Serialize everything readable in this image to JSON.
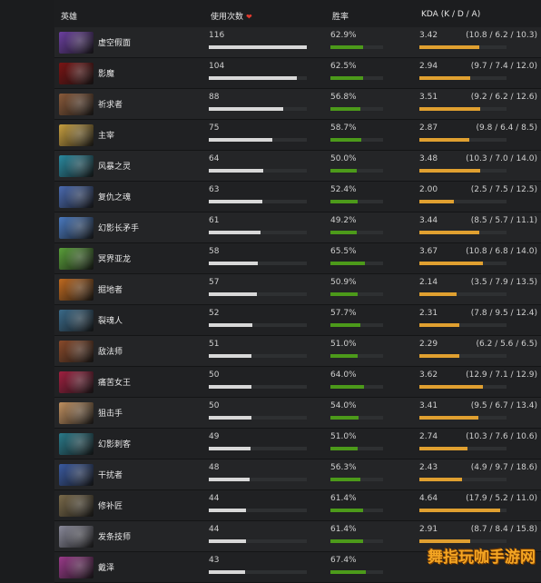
{
  "header": {
    "hero": "英雄",
    "matches": "使用次数",
    "win_rate": "胜率",
    "kda": "KDA (K / D / A)"
  },
  "max_matches": 116,
  "max_kda": 5.0,
  "rows": [
    {
      "hero": "虚空假面",
      "matches": "116",
      "win": "62.9%",
      "kda": "3.42",
      "kda_detail": "(10.8 / 6.2 / 10.3)",
      "m": 116,
      "w": 62.9,
      "k": 3.42,
      "color": "#6b3fa0"
    },
    {
      "hero": "影魔",
      "matches": "104",
      "win": "62.5%",
      "kda": "2.94",
      "kda_detail": "(9.7 / 7.4 / 12.0)",
      "m": 104,
      "w": 62.5,
      "k": 2.94,
      "color": "#7a1414"
    },
    {
      "hero": "祈求者",
      "matches": "88",
      "win": "56.8%",
      "kda": "3.51",
      "kda_detail": "(9.2 / 6.2 / 12.6)",
      "m": 88,
      "w": 56.8,
      "k": 3.51,
      "color": "#8a5a3a"
    },
    {
      "hero": "主宰",
      "matches": "75",
      "win": "58.7%",
      "kda": "2.87",
      "kda_detail": "(9.8 / 6.4 / 8.5)",
      "m": 75,
      "w": 58.7,
      "k": 2.87,
      "color": "#c8a040"
    },
    {
      "hero": "风暴之灵",
      "matches": "64",
      "win": "50.0%",
      "kda": "3.48",
      "kda_detail": "(10.3 / 7.0 / 14.0)",
      "m": 64,
      "w": 50.0,
      "k": 3.48,
      "color": "#2a8aa0"
    },
    {
      "hero": "复仇之魂",
      "matches": "63",
      "win": "52.4%",
      "kda": "2.00",
      "kda_detail": "(2.5 / 7.5 / 12.5)",
      "m": 63,
      "w": 52.4,
      "k": 2.0,
      "color": "#4a6ab0"
    },
    {
      "hero": "幻影长矛手",
      "matches": "61",
      "win": "49.2%",
      "kda": "3.44",
      "kda_detail": "(8.5 / 5.7 / 11.1)",
      "m": 61,
      "w": 49.2,
      "k": 3.44,
      "color": "#4a7ac0"
    },
    {
      "hero": "冥界亚龙",
      "matches": "58",
      "win": "65.5%",
      "kda": "3.67",
      "kda_detail": "(10.8 / 6.8 / 14.0)",
      "m": 58,
      "w": 65.5,
      "k": 3.67,
      "color": "#5aa03a"
    },
    {
      "hero": "掘地者",
      "matches": "57",
      "win": "50.9%",
      "kda": "2.14",
      "kda_detail": "(3.5 / 7.9 / 13.5)",
      "m": 57,
      "w": 50.9,
      "k": 2.14,
      "color": "#c06a20"
    },
    {
      "hero": "裂魂人",
      "matches": "52",
      "win": "57.7%",
      "kda": "2.31",
      "kda_detail": "(7.8 / 9.5 / 12.4)",
      "m": 52,
      "w": 57.7,
      "k": 2.31,
      "color": "#3a6a8a"
    },
    {
      "hero": "敌法师",
      "matches": "51",
      "win": "51.0%",
      "kda": "2.29",
      "kda_detail": "(6.2 / 5.6 / 6.5)",
      "m": 51,
      "w": 51.0,
      "k": 2.29,
      "color": "#8a4a2a"
    },
    {
      "hero": "痛苦女王",
      "matches": "50",
      "win": "64.0%",
      "kda": "3.62",
      "kda_detail": "(12.9 / 7.1 / 12.9)",
      "m": 50,
      "w": 64.0,
      "k": 3.62,
      "color": "#a02040"
    },
    {
      "hero": "狙击手",
      "matches": "50",
      "win": "54.0%",
      "kda": "3.41",
      "kda_detail": "(9.5 / 6.7 / 13.4)",
      "m": 50,
      "w": 54.0,
      "k": 3.41,
      "color": "#c09060"
    },
    {
      "hero": "幻影刺客",
      "matches": "49",
      "win": "51.0%",
      "kda": "2.74",
      "kda_detail": "(10.3 / 7.6 / 10.6)",
      "m": 49,
      "w": 51.0,
      "k": 2.74,
      "color": "#2a7a8a"
    },
    {
      "hero": "干扰者",
      "matches": "48",
      "win": "56.3%",
      "kda": "2.43",
      "kda_detail": "(4.9 / 9.7 / 18.6)",
      "m": 48,
      "w": 56.3,
      "k": 2.43,
      "color": "#3a5aa0"
    },
    {
      "hero": "修补匠",
      "matches": "44",
      "win": "61.4%",
      "kda": "4.64",
      "kda_detail": "(17.9 / 5.2 / 11.0)",
      "m": 44,
      "w": 61.4,
      "k": 4.64,
      "color": "#7a6a4a"
    },
    {
      "hero": "发条技师",
      "matches": "44",
      "win": "61.4%",
      "kda": "2.91",
      "kda_detail": "(8.7 / 8.4 / 15.8)",
      "m": 44,
      "w": 61.4,
      "k": 2.91,
      "color": "#8a8a9a"
    },
    {
      "hero": "戴泽",
      "matches": "43",
      "win": "67.4%",
      "kda": "",
      "kda_detail": "",
      "m": 43,
      "w": 67.4,
      "k": 0,
      "color": "#9a3a8a"
    }
  ],
  "watermark": "舞指玩咖手游网"
}
